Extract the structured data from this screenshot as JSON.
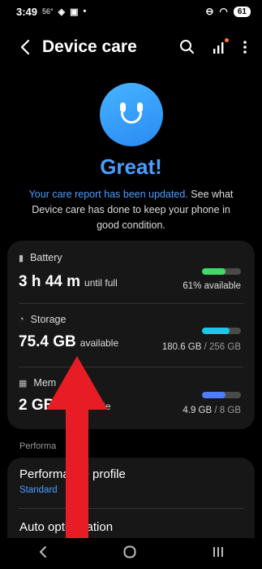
{
  "status_bar": {
    "time": "3:49",
    "temp": "56°",
    "battery": "61"
  },
  "app_bar": {
    "title": "Device care"
  },
  "summary": {
    "headline": "Great!",
    "report_link": "Your care report has been updated.",
    "report_text": " See what Device care has done to keep your phone in good condition."
  },
  "battery": {
    "label": "Battery",
    "value": "3 h 44 m",
    "suffix": "until full",
    "detail": "61% available",
    "level": 0.61,
    "color": "#3ddc68"
  },
  "storage": {
    "label": "Storage",
    "value": "75.4 GB",
    "suffix": "available",
    "used": "180.6 GB",
    "total": "/ 256 GB",
    "level": 0.71,
    "color": "#1cc8e8"
  },
  "memory": {
    "label": "Mem",
    "value": "2 GB",
    "suffix": "ble",
    "used": "4.9 GB",
    "total": "/ 8 GB",
    "level": 0.61,
    "color": "#4c7dfc"
  },
  "section": {
    "label": "Performa"
  },
  "performance": {
    "title": "Performance profile",
    "value": "Standard"
  },
  "auto_optimization": {
    "title": "Auto optimization"
  },
  "annotation": {
    "arrow_color": "#e81c24"
  },
  "icons": {
    "back": "back-arrow-icon",
    "search": "search-icon",
    "bars": "bars-chart-icon",
    "more": "more-vert-icon"
  }
}
